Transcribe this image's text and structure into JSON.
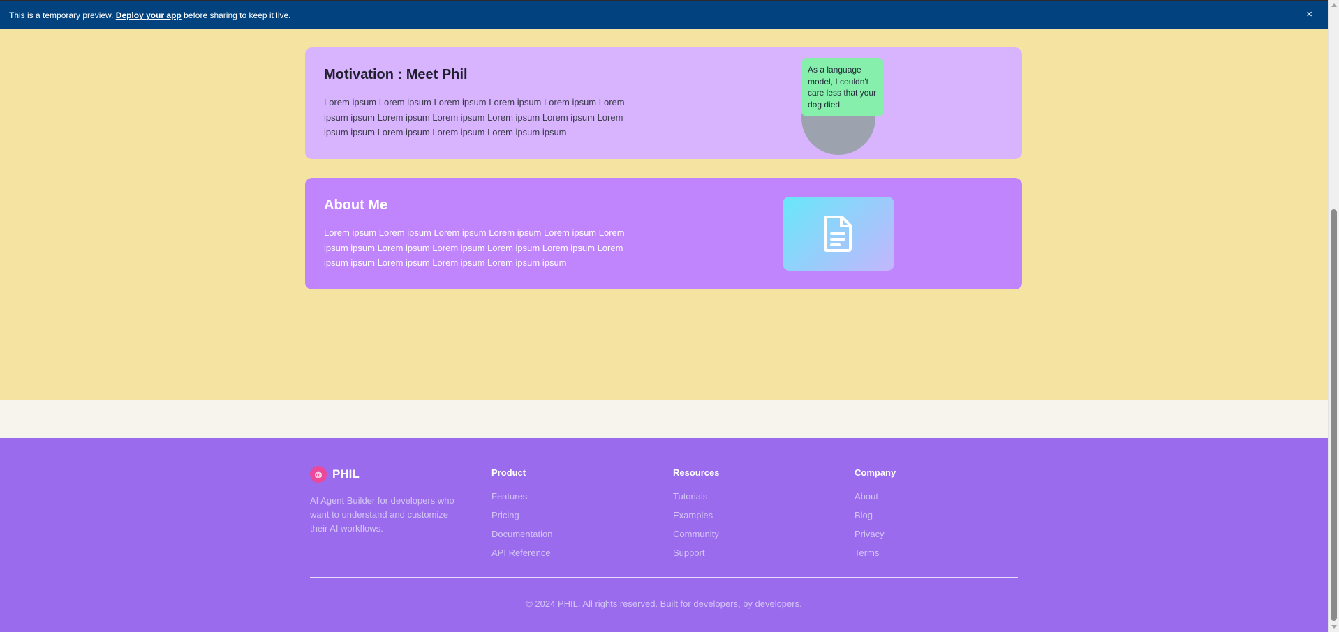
{
  "banner": {
    "prefix": "This is a temporary preview.",
    "link": "Deploy your app",
    "suffix": "before sharing to keep it live.",
    "close": "×"
  },
  "motivation": {
    "title": "Motivation : Meet Phil",
    "body": "Lorem ipsum Lorem ipsum Lorem ipsum Lorem ipsum Lorem ipsum Lorem ipsum ipsum Lorem ipsum Lorem ipsum Lorem ipsum Lorem ipsum Lorem ipsum ipsum Lorem ipsum Lorem ipsum Lorem ipsum ipsum",
    "speech": "As a language model, I couldn't care less that your dog died"
  },
  "about": {
    "title": "About Me",
    "body": "Lorem ipsum Lorem ipsum Lorem ipsum Lorem ipsum Lorem ipsum Lorem ipsum ipsum Lorem ipsum Lorem ipsum Lorem ipsum Lorem ipsum Lorem ipsum ipsum Lorem ipsum Lorem ipsum Lorem ipsum ipsum",
    "icon": "document-icon"
  },
  "footer": {
    "brand": "PHIL",
    "brand_icon": "robot-icon",
    "tagline": "AI Agent Builder for developers who want to understand and customize their AI workflows.",
    "columns": [
      {
        "title": "Product",
        "links": [
          "Features",
          "Pricing",
          "Documentation",
          "API Reference"
        ]
      },
      {
        "title": "Resources",
        "links": [
          "Tutorials",
          "Examples",
          "Community",
          "Support"
        ]
      },
      {
        "title": "Company",
        "links": [
          "About",
          "Blog",
          "Privacy",
          "Terms"
        ]
      }
    ],
    "copyright": "© 2024 PHIL. All rights reserved. Built for developers, by developers."
  },
  "colors": {
    "page_bg": "#f5e4a1",
    "banner_bg": "#02437f",
    "motivation_card": "#d8b4fe",
    "about_card": "#c084fc",
    "speech_bubble": "#86efac",
    "footer_bg": "#9b6bee",
    "brand_logo": "#ec4899"
  }
}
